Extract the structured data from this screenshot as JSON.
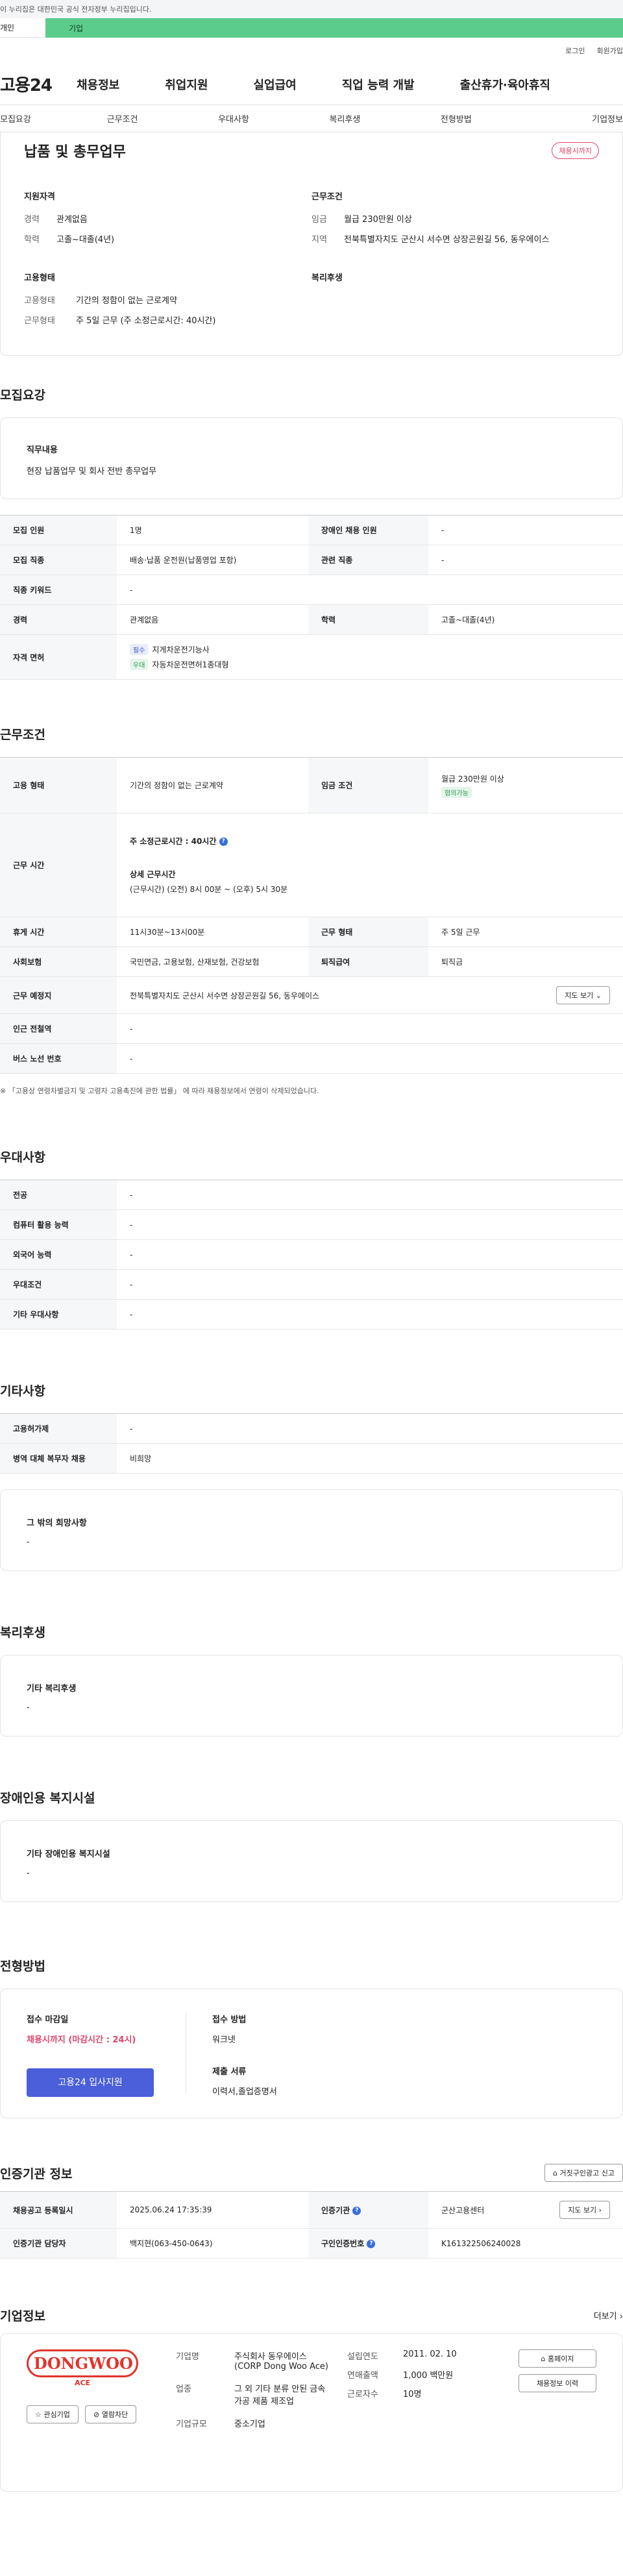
{
  "top": {
    "notice": "이 누리집은 대한민국 공식 전자정부 누리집입니다.",
    "tab1": "개인",
    "tab2": "기업"
  },
  "util": {
    "login": "로그인",
    "join": "회원가입"
  },
  "gnb": {
    "logo": "고용24",
    "items": [
      "채용정보",
      "취업지원",
      "실업급여",
      "직업 능력 개발",
      "출산휴가·육아휴직"
    ]
  },
  "subnav": [
    "모집요강",
    "근무조건",
    "우대사항",
    "복리후생",
    "전형방법",
    "기업정보"
  ],
  "summary": {
    "title": "납품 및 총무업무",
    "badge": "채용시까지",
    "qual_title": "지원자격",
    "work_title": "근무조건",
    "career_k": "경력",
    "career_v": "관계없음",
    "edu_k": "학력",
    "edu_v": "고졸~대졸(4년)",
    "wage_k": "임금",
    "wage_v": "월급 230만원 이상",
    "area_k": "지역",
    "area_v": "전북특별자치도 군산시 서수면 상장곤원길 56, 동우에이스",
    "emp_title": "고용형태",
    "welfare_title": "복리후생",
    "emptype_k": "고용형태",
    "emptype_v": "기간의 정함이 없는 근로계약",
    "worktype_k": "근무형태",
    "worktype_v": "주 5일 근무 (주 소정근로시간: 40시간)"
  },
  "recruit": {
    "section": "모집요강",
    "duty_label": "직무내용",
    "duty_text": "현장 납품업무 및 회사 전반 총무업무",
    "rows": {
      "headcount_k": "모집 인원",
      "headcount_v": "1명",
      "disabled_k": "장애인 채용 인원",
      "disabled_v": "-",
      "job_k": "모집 직종",
      "job_v": "배송·납품 운전원(납품영업 포함)",
      "related_k": "관련 직종",
      "related_v": "-",
      "keyword_k": "직종 키워드",
      "keyword_v": "-",
      "career_k": "경력",
      "career_v": "관계없음",
      "edu_k": "학력",
      "edu_v": "고졸~대졸(4년)",
      "license_k": "자격 면허",
      "lic1_tag": "필수",
      "lic1": "지게차운전기능사",
      "lic2_tag": "우대",
      "lic2": "자동차운전면허1종대형"
    }
  },
  "work": {
    "section": "근무조건",
    "emptype_k": "고용 형태",
    "emptype_v": "기간의 정함이 없는 근로계약",
    "wage_k": "임금 조건",
    "wage_v": "월급 230만원 이상",
    "wage_tag": "협의가능",
    "hours_k": "근무 시간",
    "hours_main": "주 소정근로시간 : 40시간",
    "hours_detail_label": "상세 근무시간",
    "hours_detail": "(근무시간) (오전) 8시 00분 ~ (오후) 5시 30분",
    "break_k": "휴게 시간",
    "break_v": "11시30분~13시00분",
    "worktype_k": "근무 형태",
    "worktype_v": "주 5일 근무",
    "insure_k": "사회보험",
    "insure_v": "국민연금, 고용보험, 산재보험, 건강보험",
    "retire_k": "퇴직급여",
    "retire_v": "퇴직금",
    "place_k": "근무 예정지",
    "place_v": "전북특별자치도 군산시 서수면 상장곤원길 56, 동우에이스",
    "map_btn": "지도 보기",
    "station_k": "인근 전철역",
    "station_v": "-",
    "bus_k": "버스 노선 번호",
    "bus_v": "-",
    "note": "※ 「고용상 연령차별금지 및 고령자 고용촉진에 관한 법률」 에 따라 채용정보에서 연령이 삭제되었습니다."
  },
  "pref": {
    "section": "우대사항",
    "major_k": "전공",
    "major_v": "-",
    "computer_k": "컴퓨터 활용 능력",
    "computer_v": "-",
    "lang_k": "외국어 능력",
    "lang_v": "-",
    "cond_k": "우대조건",
    "cond_v": "-",
    "etc_k": "기타 우대사항",
    "etc_v": "-"
  },
  "etc": {
    "section": "기타사항",
    "subsidy_k": "고용허가제",
    "subsidy_v": "-",
    "military_k": "병역 대체 복무자 채용",
    "military_v": "비희망",
    "other_label": "그 밖의 희망사항",
    "other_v": "-"
  },
  "welfare": {
    "section": "복리후생",
    "label": "기타 복리후생",
    "value": "-"
  },
  "disability": {
    "section": "장애인용 복지시설",
    "label": "기타 장애인용 복지시설",
    "value": "-"
  },
  "process": {
    "section": "전형방법",
    "deadline_label": "접수 마감일",
    "deadline_value": "채용시까지 (마감시간 : 24시)",
    "apply_btn": "고용24 입사지원",
    "method_label": "접수 방법",
    "method_value": "워크넷",
    "docs_label": "제출 서류",
    "docs_value": "이력서,졸업증명서"
  },
  "cert": {
    "section": "인증기관 정보",
    "report_btn": "거짓구인광고 신고",
    "reg_k": "채용공고 등록일시",
    "reg_v": "2025.06.24 17:35:39",
    "org_k": "인증기관",
    "org_v": "군산고용센터",
    "map_btn": "지도 보기",
    "manager_k": "인증기관 담당자",
    "manager_v": "백지현(063-450-0643)",
    "jobno_k": "구인인증번호",
    "jobno_v": "K161322506240028"
  },
  "company": {
    "section": "기업정보",
    "more": "더보기",
    "logo_text": "DONGWOO",
    "logo_sub": "ACE",
    "fav_btn": "관심기업",
    "block_btn": "열람차단",
    "name_k": "기업명",
    "name_v": "주식회사 동우에이스 (CORP Dong Woo Ace)",
    "industry_k": "업종",
    "industry_v": "그 외 기타 분류 안된 금속 가공 제품 제조업",
    "size_k": "기업규모",
    "size_v": "중소기업",
    "founded_k": "설립연도",
    "founded_v": "2011. 02. 10",
    "sales_k": "연매출액",
    "sales_v": "1,000 백만원",
    "staff_k": "근로자수",
    "staff_v": "10명",
    "home_btn": "홈페이지",
    "history_btn": "채용정보 이력"
  }
}
